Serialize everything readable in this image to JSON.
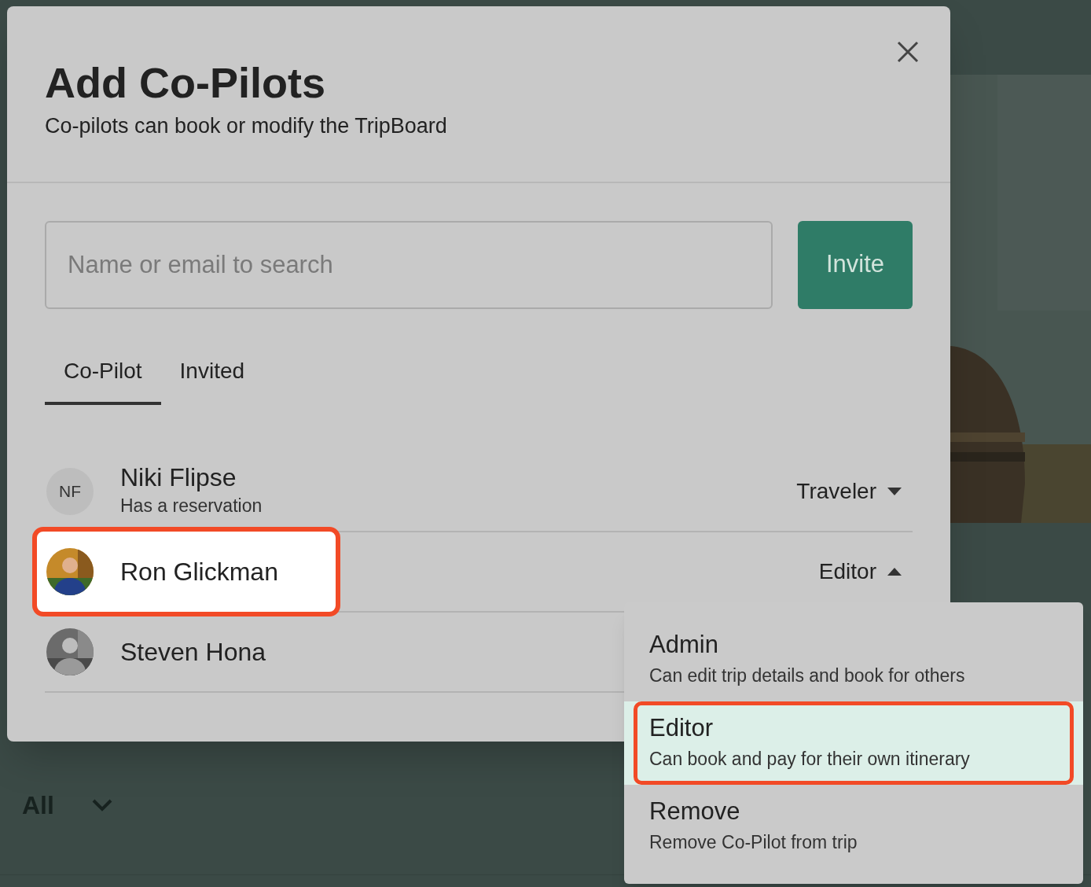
{
  "modal": {
    "title": "Add Co-Pilots",
    "subtitle": "Co-pilots can book or modify the TripBoard",
    "search": {
      "placeholder": "Name or email to search"
    },
    "invite_button": "Invite",
    "tabs": [
      {
        "label": "Co-Pilot",
        "selected": true
      },
      {
        "label": "Invited",
        "selected": false
      }
    ],
    "members": [
      {
        "name": "Niki Flipse",
        "note": "Has a reservation",
        "avatar": {
          "kind": "initials",
          "text": "NF"
        },
        "role": "Traveler",
        "expanded": false,
        "highlighted": false
      },
      {
        "name": "Ron Glickman",
        "role": "Editor",
        "expanded": true,
        "highlighted": true
      },
      {
        "name": "Steven Hona",
        "highlighted": false
      }
    ]
  },
  "role_menu": {
    "items": [
      {
        "label": "Admin",
        "description": "Can edit trip details and book for others",
        "selected": false,
        "highlighted": false
      },
      {
        "label": "Editor",
        "description": "Can book and pay for their own itinerary",
        "selected": true,
        "highlighted": true
      },
      {
        "label": "Remove",
        "description": "Remove Co-Pilot from trip",
        "selected": false,
        "highlighted": false
      }
    ]
  },
  "background": {
    "filter": "All"
  }
}
